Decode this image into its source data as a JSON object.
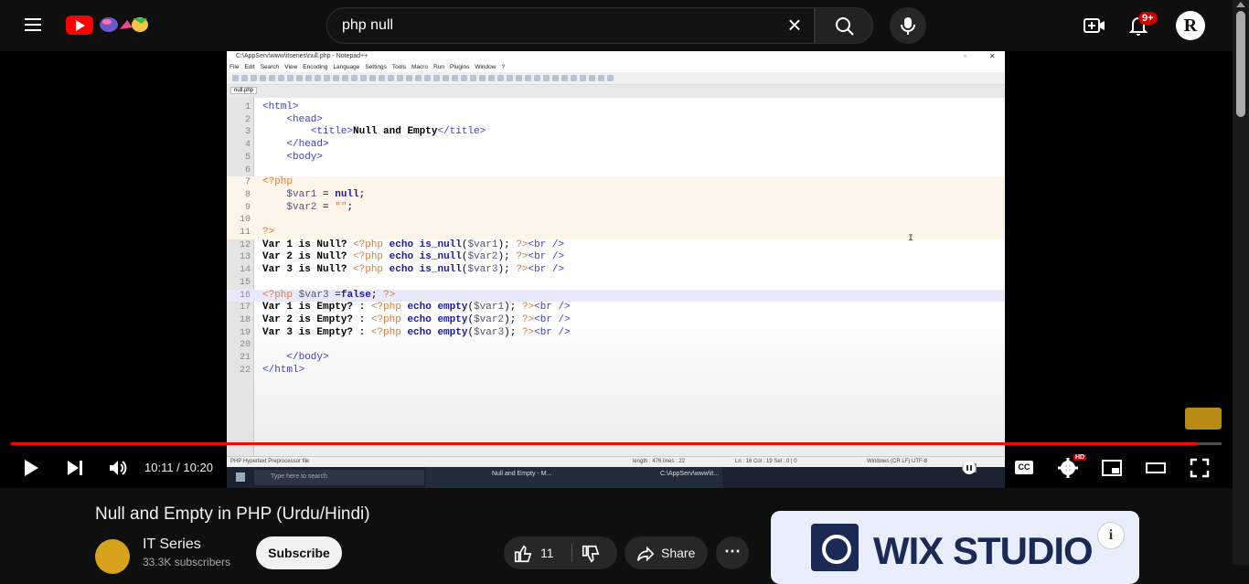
{
  "search": {
    "query": "php null"
  },
  "header": {
    "notifications_badge": "9+",
    "avatar_letter": "R"
  },
  "video": {
    "time_display": "10:11 / 10:20",
    "progress_fraction": 0.98,
    "hd_badge": "HD",
    "cc_label": "CC"
  },
  "screen": {
    "window_title": "C:\\AppServ\\www\\itseries\\null.php - Notepad++",
    "menu": [
      "File",
      "Edit",
      "Search",
      "View",
      "Encoding",
      "Language",
      "Settings",
      "Tools",
      "Macro",
      "Run",
      "Plugins",
      "Window",
      "?"
    ],
    "tab": "null.php",
    "status_left": "PHP Hypertext Preprocessor file",
    "status_mid": "length : 476   lines : 22",
    "status_pos": "Ln : 16   Col : 19   Sel : 0 | 0",
    "status_right": "Windows (CR LF)   UTF-8",
    "taskbar_search": "Type here to search",
    "taskbar_app1": "Null and Empty - M...",
    "taskbar_app2": "C:\\AppServ\\www\\it...",
    "code_lines": [
      "1",
      "2",
      "3",
      "4",
      "5",
      "6",
      "7",
      "8",
      "9",
      "10",
      "11",
      "12",
      "13",
      "14",
      "15",
      "16",
      "17",
      "18",
      "19",
      "20",
      "21",
      "22"
    ]
  },
  "info": {
    "title": "Null and Empty in PHP (Urdu/Hindi)",
    "channel": "IT Series",
    "subscribers": "33.3K subscribers",
    "subscribe_label": "Subscribe",
    "likes": "11",
    "share_label": "Share",
    "ad_text": "WIX STUDIO",
    "channel_avatar_text": "IT Series"
  }
}
